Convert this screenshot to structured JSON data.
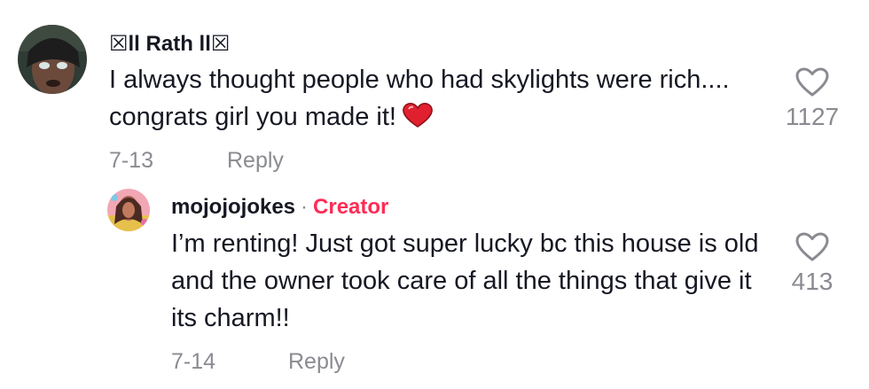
{
  "comments": [
    {
      "username": "☒ll Rath ll☒",
      "text": "I always thought people who had skylights were rich.... congrats girl you made it!",
      "emoji": "red-heart-emoji",
      "date": "7-13",
      "reply_label": "Reply",
      "like_count": "1127",
      "like_icon": "heart-outline-icon"
    }
  ],
  "replies": [
    {
      "username": "mojojojokes",
      "separator": "·",
      "badge": "Creator",
      "text": "I’m renting! Just got super lucky bc this house is old and the owner took care of all the things that give it its charm!!",
      "date": "7-14",
      "reply_label": "Reply",
      "like_count": "413",
      "like_icon": "heart-outline-icon"
    }
  ],
  "colors": {
    "text": "#161823",
    "muted": "#8a8b91",
    "creator_badge": "#fe2c55",
    "emoji_heart": "#e0202e"
  }
}
